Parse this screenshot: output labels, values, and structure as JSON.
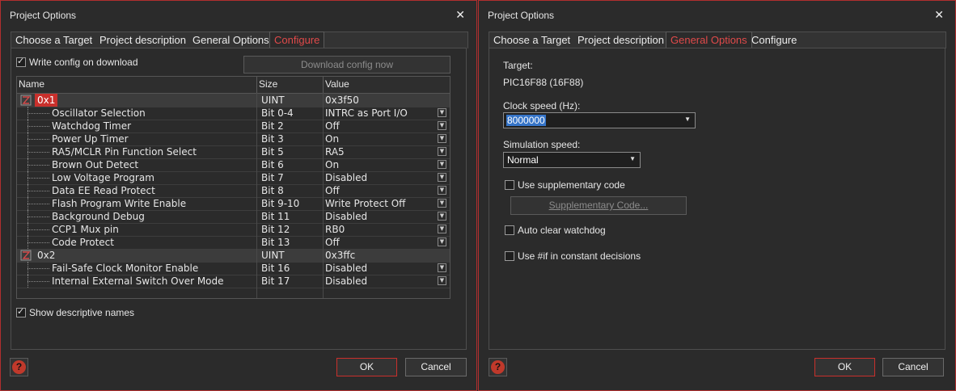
{
  "left_dialog": {
    "title": "Project Options",
    "close_glyph": "✕",
    "tabs": [
      "Choose a Target",
      "Project description",
      "General Options",
      "Configure"
    ],
    "active_tab": "Configure",
    "write_config_label": "Write config on download",
    "write_config_checked": true,
    "download_button": "Download config now",
    "grid": {
      "headers": [
        "Name",
        "Size",
        "Value"
      ],
      "groups": [
        {
          "name": "0x1",
          "size": "UINT",
          "value": "0x3f50",
          "selected": true,
          "rows": [
            {
              "name": "Oscillator Selection",
              "size": "Bit 0-4",
              "value": "INTRC as Port I/O"
            },
            {
              "name": "Watchdog Timer",
              "size": "Bit 2",
              "value": "Off"
            },
            {
              "name": "Power Up Timer",
              "size": "Bit 3",
              "value": "On"
            },
            {
              "name": "RA5/MCLR Pin Function Select",
              "size": "Bit 5",
              "value": "RA5"
            },
            {
              "name": "Brown Out Detect",
              "size": "Bit 6",
              "value": "On"
            },
            {
              "name": "Low Voltage Program",
              "size": "Bit 7",
              "value": "Disabled"
            },
            {
              "name": "Data EE Read Protect",
              "size": "Bit 8",
              "value": "Off"
            },
            {
              "name": "Flash Program Write Enable",
              "size": "Bit 9-10",
              "value": "Write Protect Off"
            },
            {
              "name": "Background Debug",
              "size": "Bit 11",
              "value": "Disabled"
            },
            {
              "name": "CCP1 Mux pin",
              "size": "Bit 12",
              "value": "RB0"
            },
            {
              "name": "Code Protect",
              "size": "Bit 13",
              "value": "Off"
            }
          ]
        },
        {
          "name": "0x2",
          "size": "UINT",
          "value": "0x3ffc",
          "selected": false,
          "rows": [
            {
              "name": "Fail-Safe Clock Monitor Enable",
              "size": "Bit 16",
              "value": "Disabled"
            },
            {
              "name": "Internal External Switch Over Mode",
              "size": "Bit 17",
              "value": "Disabled"
            }
          ]
        }
      ]
    },
    "descriptive_names_label": "Show descriptive names",
    "descriptive_names_checked": true,
    "ok": "OK",
    "cancel": "Cancel",
    "help_glyph": "?"
  },
  "right_dialog": {
    "title": "Project Options",
    "close_glyph": "✕",
    "tabs": [
      "Choose a Target",
      "Project description",
      "General Options",
      "Configure"
    ],
    "active_tab": "General Options",
    "target_label": "Target:",
    "target_value": "PIC16F88 (16F88)",
    "clock_label": "Clock speed (Hz):",
    "clock_value": "8000000",
    "sim_label": "Simulation speed:",
    "sim_value": "Normal",
    "supp_code_label": "Use supplementary code",
    "supp_code_checked": false,
    "supp_code_button": "Supplementary Code...",
    "auto_clear_label": "Auto clear watchdog",
    "auto_clear_checked": false,
    "use_if_label": "Use #if in constant decisions",
    "use_if_checked": false,
    "ok": "OK",
    "cancel": "Cancel",
    "help_glyph": "?"
  },
  "colors": {
    "accent": "#c9302c",
    "background": "#2b2b2b",
    "selection": "#3574c8"
  }
}
